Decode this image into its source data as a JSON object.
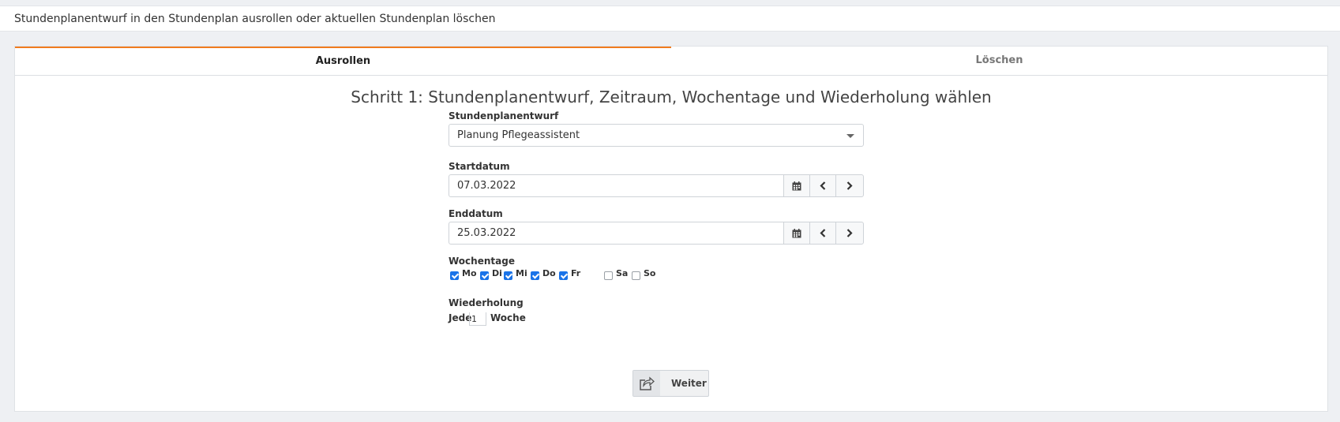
{
  "header": {
    "title": "Stundenplanentwurf in den Stundenplan ausrollen oder aktuellen Stundenplan löschen"
  },
  "tabs": [
    {
      "label": "Ausrollen",
      "active": true
    },
    {
      "label": "Löschen",
      "active": false
    }
  ],
  "step": {
    "title": "Schritt 1: Stundenplanentwurf, Zeitraum, Wochentage und Wiederholung wählen"
  },
  "draft": {
    "label": "Stundenplanentwurf",
    "selected": "Planung Pflegeassistent"
  },
  "start": {
    "label": "Startdatum",
    "value": "07.03.2022"
  },
  "end": {
    "label": "Enddatum",
    "value": "25.03.2022"
  },
  "weekdays": {
    "label": "Wochentage",
    "days": [
      {
        "label": "Mo",
        "checked": true
      },
      {
        "label": "Di",
        "checked": true
      },
      {
        "label": "Mi",
        "checked": true
      },
      {
        "label": "Do",
        "checked": true
      },
      {
        "label": "Fr",
        "checked": true
      },
      {
        "label": "Sa",
        "checked": false
      },
      {
        "label": "So",
        "checked": false
      }
    ]
  },
  "repeat": {
    "label": "Wiederholung",
    "prefix": "Jede",
    "value": "1",
    "suffix": "Woche"
  },
  "actions": {
    "next_label": "Weiter"
  },
  "colors": {
    "accent": "#f07b1d",
    "checkbox": "#1a73e8"
  }
}
